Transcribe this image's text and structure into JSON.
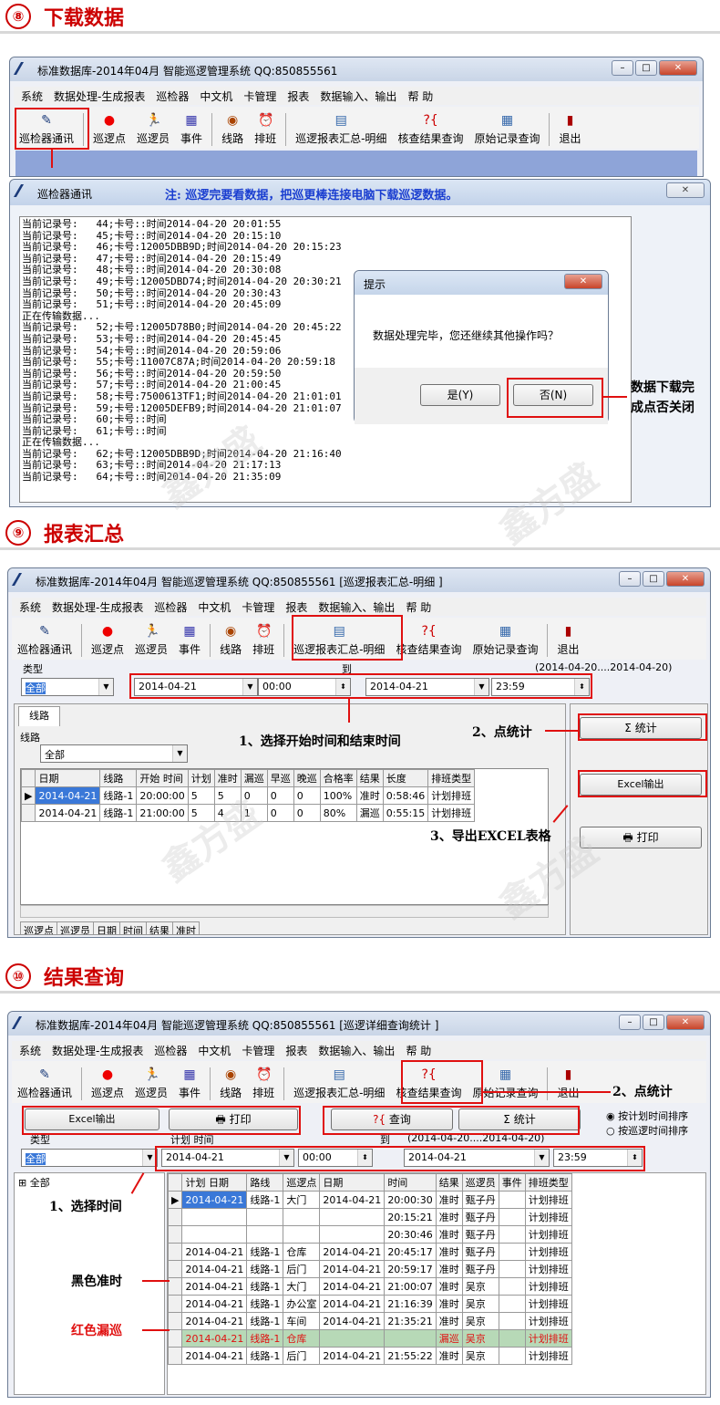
{
  "sections": [
    {
      "num": "⑧",
      "title": "下载数据"
    },
    {
      "num": "⑨",
      "title": "报表汇总"
    },
    {
      "num": "⑩",
      "title": "结果查询"
    }
  ],
  "s8": {
    "window_title": "标准数据库-2014年04月  智能巡逻管理系统  QQ:850855561",
    "menu": [
      "系统",
      "数据处理-生成报表",
      "巡检器",
      "中文机",
      "卡管理",
      "报表",
      "数据输入、输出",
      "帮 助"
    ],
    "toolbar": [
      {
        "label": "巡检器通讯",
        "icon": "pen-icon"
      },
      {
        "label": "巡逻点",
        "icon": "red-dot-icon"
      },
      {
        "label": "巡逻员",
        "icon": "runner-icon"
      },
      {
        "label": "事件",
        "icon": "event-icon"
      },
      {
        "label": "线路",
        "icon": "route-icon"
      },
      {
        "label": "排班",
        "icon": "clock-icon"
      },
      {
        "label": "巡逻报表汇总-明细",
        "icon": "report-icon"
      },
      {
        "label": "核查结果查询",
        "icon": "query-icon"
      },
      {
        "label": "原始记录查询",
        "icon": "table-icon"
      },
      {
        "label": "退出",
        "icon": "exit-icon"
      }
    ],
    "comm_title": "巡检器通讯",
    "comm_note": "注: 巡逻完要看数据，把巡更棒连接电脑下载巡逻数据。",
    "log": [
      "当前记录号:   44;卡号::时间2014-04-20 20:01:55",
      "当前记录号:   45;卡号::时间2014-04-20 20:15:10",
      "当前记录号:   46;卡号:12005DBB9D;时间2014-04-20 20:15:23",
      "当前记录号:   47;卡号::时间2014-04-20 20:15:49",
      "当前记录号:   48;卡号::时间2014-04-20 20:30:08",
      "当前记录号:   49;卡号:12005DBD74;时间2014-04-20 20:30:21",
      "当前记录号:   50;卡号::时间2014-04-20 20:30:43",
      "当前记录号:   51;卡号::时间2014-04-20 20:45:09",
      "正在传输数据...",
      "当前记录号:   52;卡号:12005D78B0;时间2014-04-20 20:45:22",
      "当前记录号:   53;卡号::时间2014-04-20 20:45:45",
      "当前记录号:   54;卡号::时间2014-04-20 20:59:06",
      "当前记录号:   55;卡号:11007C87A;时间2014-04-20 20:59:18",
      "当前记录号:   56;卡号::时间2014-04-20 20:59:50",
      "当前记录号:   57;卡号::时间2014-04-20 21:00:45",
      "当前记录号:   58;卡号:7500613TF1;时间2014-04-20 21:01:01",
      "当前记录号:   59;卡号:12005DEFB9;时间2014-04-20 21:01:07",
      "当前记录号:   60;卡号::时间",
      "当前记录号:   61;卡号::时间",
      "正在传输数据...",
      "当前记录号:   62;卡号:12005DBB9D;时间2014-04-20 21:16:40",
      "当前记录号:   63;卡号::时间2014-04-20 21:17:13",
      "当前记录号:   64;卡号::时间2014-04-20 21:35:09"
    ],
    "dialog_title": "提示",
    "dialog_msg": "数据处理完毕，您还继续其他操作吗？",
    "yes_btn": "是(Y)",
    "no_btn": "否(N)",
    "annotation": [
      "数据下载完",
      "成点否关闭"
    ]
  },
  "s9": {
    "window_title": "标准数据库-2014年04月  智能巡逻管理系统 QQ:850855561 [巡逻报表汇总-明细 ]",
    "type_label": "类型",
    "type_value": "全部",
    "to_label": "到",
    "range_text": "(2014-04-20....2014-04-20)",
    "start_date": "2014-04-21",
    "start_time": "00:00",
    "end_date": "2014-04-21",
    "end_time": "23:59",
    "tab": "线路",
    "route_label": "线路",
    "route_value": "全部",
    "ann1": "1、选择开始时间和结束时间",
    "ann2": "2、点统计",
    "ann3": "3、导出EXCEL表格",
    "stat_btn": "Σ 统计",
    "excel_btn": "Excel输出",
    "print_btn": "打印",
    "headers": [
      "日期",
      "线路",
      "开始 时间",
      "计划",
      "准时",
      "漏巡",
      "早巡",
      "晚巡",
      "合格率",
      "结果",
      "长度",
      "排班类型"
    ],
    "rows": [
      [
        "2014-04-21",
        "线路-1",
        "20:00:00",
        "5",
        "5",
        "0",
        "0",
        "0",
        "100%",
        "准时",
        "0:58:46",
        "计划排班"
      ],
      [
        "2014-04-21",
        "线路-1",
        "21:00:00",
        "5",
        "4",
        "1",
        "0",
        "0",
        "80%",
        "漏巡",
        "0:55:15",
        "计划排班"
      ]
    ],
    "footer_headers": [
      "巡逻点",
      "巡逻员",
      "日期",
      "时间",
      "结果",
      "准时"
    ]
  },
  "s10": {
    "window_title": "标准数据库-2014年04月  智能巡逻管理系统 QQ:850855561 [巡逻详细查询统计 ]",
    "excel_btn": "Excel输出",
    "print_btn": "打印",
    "query_btn": "查询",
    "stat_btn": "Σ 统计",
    "radio1": "按计划时间排序",
    "radio2": "按巡逻时间排序",
    "type_label": "类型",
    "plan_label": "计划 时间",
    "to_label": "到",
    "range_text": "(2014-04-20....2014-04-20)",
    "type_value": "全部",
    "start_date": "2014-04-21",
    "start_time": "00:00",
    "end_date": "2014-04-21",
    "end_time": "23:59",
    "tree_root": "全部",
    "ann1": "1、选择时间",
    "ann2": "2、点统计",
    "ann_black": "黑色准时",
    "ann_red": "红色漏巡",
    "headers": [
      "计划 日期",
      "路线",
      "巡逻点",
      "日期",
      "时间",
      "结果",
      "巡逻员",
      "事件",
      "排班类型"
    ],
    "rows": [
      [
        "2014-04-21",
        "线路-1",
        "大门",
        "2014-04-21",
        "20:00:30",
        "准时",
        "甄子丹",
        "",
        "计划排班"
      ],
      [
        "",
        "",
        "",
        "",
        "20:15:21",
        "准时",
        "甄子丹",
        "",
        "计划排班"
      ],
      [
        "",
        "",
        "",
        "",
        "20:30:46",
        "准时",
        "甄子丹",
        "",
        "计划排班"
      ],
      [
        "2014-04-21",
        "线路-1",
        "仓库",
        "2014-04-21",
        "20:45:17",
        "准时",
        "甄子丹",
        "",
        "计划排班"
      ],
      [
        "2014-04-21",
        "线路-1",
        "后门",
        "2014-04-21",
        "20:59:17",
        "准时",
        "甄子丹",
        "",
        "计划排班"
      ],
      [
        "2014-04-21",
        "线路-1",
        "大门",
        "2014-04-21",
        "21:00:07",
        "准时",
        "吴京",
        "",
        "计划排班"
      ],
      [
        "2014-04-21",
        "线路-1",
        "办公室",
        "2014-04-21",
        "21:16:39",
        "准时",
        "吴京",
        "",
        "计划排班"
      ],
      [
        "2014-04-21",
        "线路-1",
        "车间",
        "2014-04-21",
        "21:35:21",
        "准时",
        "吴京",
        "",
        "计划排班"
      ],
      [
        "2014-04-21",
        "线路-1",
        "仓库",
        "",
        "",
        "漏巡",
        "吴京",
        "",
        "计划排班"
      ],
      [
        "2014-04-21",
        "线路-1",
        "后门",
        "2014-04-21",
        "21:55:22",
        "准时",
        "吴京",
        "",
        "计划排班"
      ]
    ],
    "red_row": 8
  },
  "watermark": "鑫方盛",
  "colors": {
    "accent_red": "#e01010",
    "title_red": "#cc0000",
    "missed_row_bg": "#b7d9b7",
    "select_blue": "#3a78d8"
  }
}
